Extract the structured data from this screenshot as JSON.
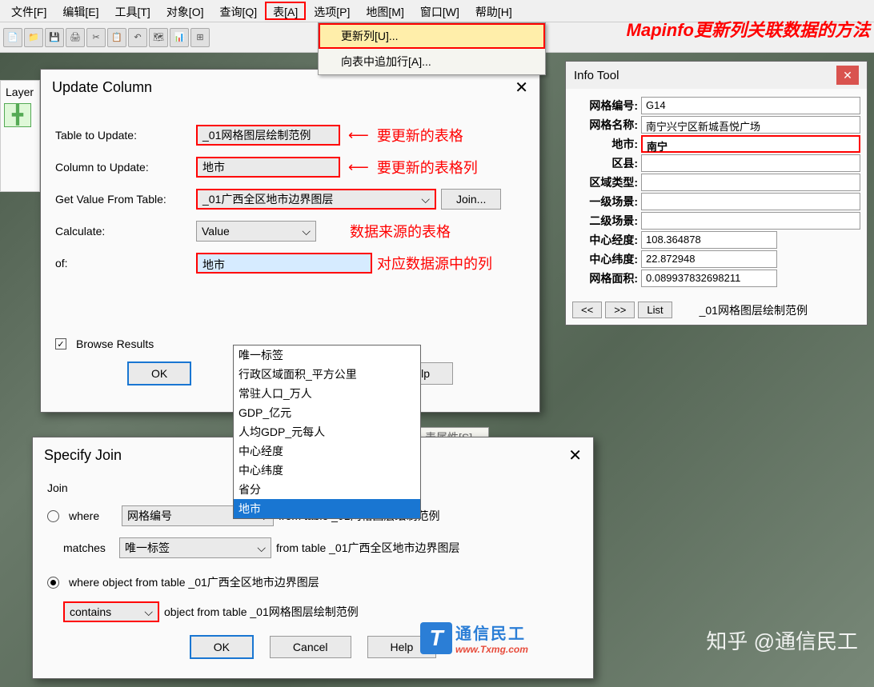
{
  "menubar": {
    "items": [
      "文件[F]",
      "编辑[E]",
      "工具[T]",
      "对象[O]",
      "查询[Q]",
      "表[A]",
      "选项[P]",
      "地图[M]",
      "窗口[W]",
      "帮助[H]"
    ],
    "highlighted_index": 5
  },
  "dropdown_menu": {
    "items": [
      "更新列[U]...",
      "向表中追加行[A]..."
    ],
    "highlighted_index": 0
  },
  "title_banner": "Mapinfo更新列关联数据的方法",
  "layers_panel": {
    "title": "Layer"
  },
  "update_column": {
    "title": "Update Column",
    "table_to_update": {
      "label": "Table to Update:",
      "value": "_01网格图层绘制范例",
      "annotation": "要更新的表格"
    },
    "column_to_update": {
      "label": "Column to Update:",
      "value": "地市",
      "annotation": "要更新的表格列"
    },
    "get_value_from": {
      "label": "Get Value From Table:",
      "value": "_01广西全区地市边界图层",
      "annotation": "数据来源的表格",
      "join_btn": "Join..."
    },
    "calculate": {
      "label": "Calculate:",
      "value": "Value"
    },
    "of": {
      "label": "of:",
      "value": "地市",
      "annotation": "对应数据源中的列"
    },
    "of_options": [
      "唯一标签",
      "行政区域面积_平方公里",
      "常驻人口_万人",
      "GDP_亿元",
      "人均GDP_元每人",
      "中心经度",
      "中心纬度",
      "省分",
      "地市"
    ],
    "browse_results": "Browse Results",
    "ok": "OK",
    "help": "Help"
  },
  "info_tool": {
    "title": "Info Tool",
    "fields": [
      {
        "label": "网格编号:",
        "value": "G14"
      },
      {
        "label": "网格名称:",
        "value": "南宁兴宁区新城吾悦广场"
      },
      {
        "label": "地市:",
        "value": "南宁",
        "highlighted": true
      },
      {
        "label": "区县:",
        "value": ""
      },
      {
        "label": "区域类型:",
        "value": ""
      },
      {
        "label": "一级场景:",
        "value": ""
      },
      {
        "label": "二级场景:",
        "value": ""
      },
      {
        "label": "中心经度:",
        "value": "108.364878"
      },
      {
        "label": "中心纬度:",
        "value": "22.872948"
      },
      {
        "label": "网格面积:",
        "value": "0.089937832698211"
      }
    ],
    "nav": {
      "prev": "<<",
      "next": ">>",
      "list": "List",
      "source": "_01网格图层绘制范例"
    }
  },
  "specify_join": {
    "title": "Specify Join",
    "join_label": "Join",
    "where_label": "where",
    "where_field": "网格编号",
    "where_from": "from table _01网格图层绘制范例",
    "matches_label": "matches",
    "matches_field": "唯一标签",
    "matches_from": "from table _01广西全区地市边界图层",
    "spatial_where": "where object from table _01广西全区地市边界图层",
    "contains": "contains",
    "spatial_object": "object from table _01网格图层绘制范例",
    "ok": "OK",
    "cancel": "Cancel",
    "help": "Help"
  },
  "wfs_partial": "WFS 表属性[S]",
  "watermark": {
    "cn": "通信民工",
    "url": "www.Txmg.com",
    "zhihu": "知乎 @通信民工"
  }
}
